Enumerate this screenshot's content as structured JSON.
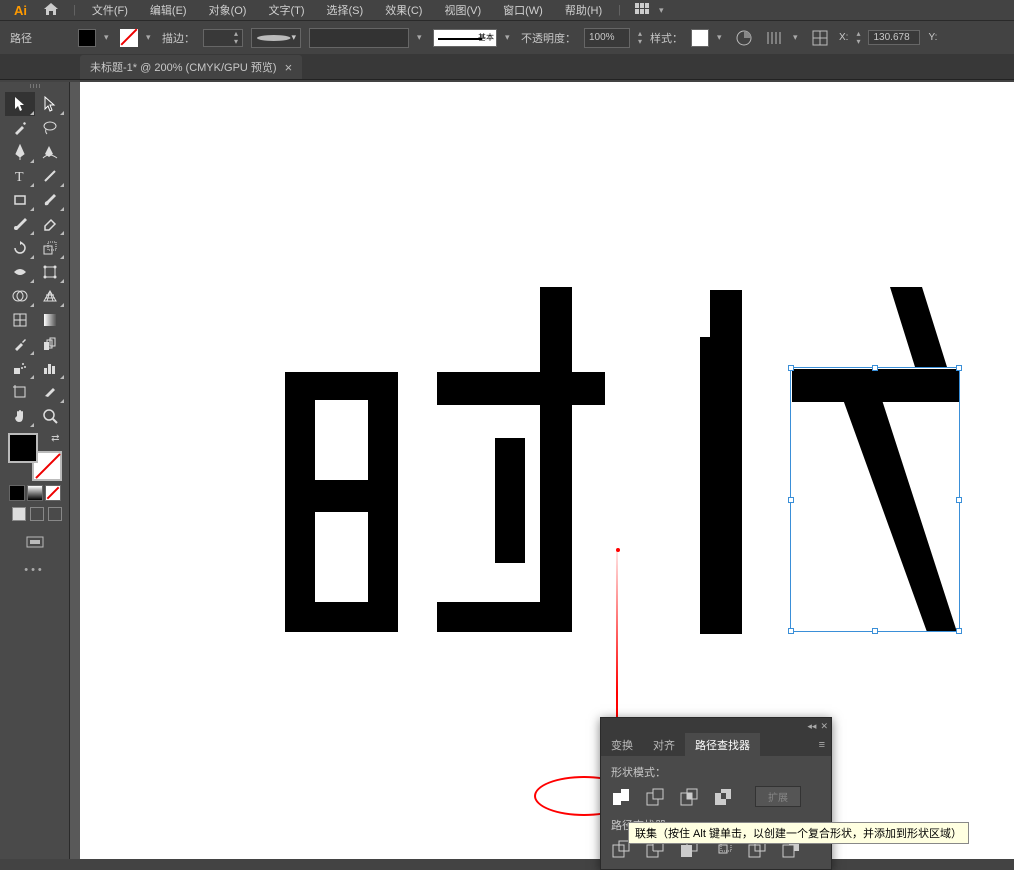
{
  "menubar": {
    "logo": "Ai",
    "items": [
      "文件(F)",
      "编辑(E)",
      "对象(O)",
      "文字(T)",
      "选择(S)",
      "效果(C)",
      "视图(V)",
      "窗口(W)",
      "帮助(H)"
    ]
  },
  "controlbar": {
    "object_type": "路径",
    "stroke_label": "描边：",
    "stroke_weight": "",
    "stroke_style": "基本",
    "opacity_label": "不透明度：",
    "opacity_value": "100%",
    "style_label": "样式：",
    "x_label": "X:",
    "x_value": "130.678",
    "y_label": "Y:"
  },
  "document_tab": {
    "title": "未标题-1* @ 200% (CMYK/GPU 预览)"
  },
  "pathfinder": {
    "tab_transform": "变换",
    "tab_align": "对齐",
    "tab_pathfinder": "路径查找器",
    "shape_modes_label": "形状模式：",
    "pathfinder_label": "路径查找器：",
    "expand_btn": "扩展",
    "tooltip": "联集（按住 Alt 键单击，以创建一个复合形状，并添加到形状区域）"
  }
}
